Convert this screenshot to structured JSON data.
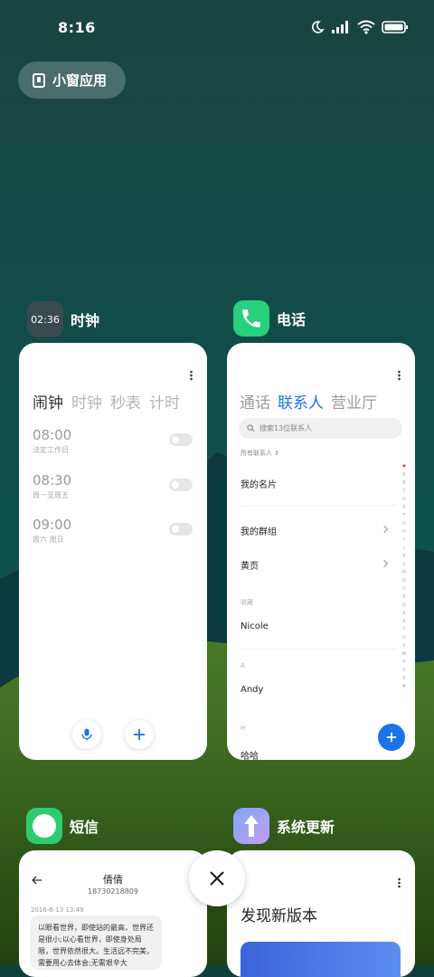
{
  "status_bar": {
    "time": "8:16"
  },
  "floating_window_button": {
    "label": "小窗应用"
  },
  "apps": {
    "clock": {
      "name": "时钟",
      "icon_time": "02:36",
      "tabs": [
        "闹钟",
        "时钟",
        "秒表",
        "计时"
      ],
      "alarms": [
        {
          "time": "08:00",
          "repeat": "法定工作日"
        },
        {
          "time": "08:30",
          "repeat": "周一至周五"
        },
        {
          "time": "09:00",
          "repeat": "周六 周日"
        }
      ]
    },
    "phone": {
      "name": "电话",
      "tabs": [
        "通话",
        "联系人",
        "营业厅"
      ],
      "search_placeholder": "搜索13位联系人",
      "filter_label": "所有联系人",
      "my_card": "我的名片",
      "my_groups": "我的群组",
      "yellow_pages": "黄页",
      "favorites_header": "收藏",
      "favorite_contact": "Nicole",
      "section_a": "A",
      "contact_a": "Andy",
      "section_h": "H",
      "contact_h": "哈哈",
      "index_letters": [
        "A",
        "B",
        "C",
        "D",
        "E",
        "F",
        "G",
        "H",
        "I",
        "J",
        "K",
        "L",
        "M",
        "N",
        "O",
        "P",
        "Q",
        "R",
        "S",
        "T",
        "U",
        "V",
        "W",
        "X",
        "Y",
        "Z",
        "#"
      ]
    },
    "messages": {
      "name": "短信",
      "contact_name": "倩倩",
      "contact_number": "18730218809",
      "timestamp": "2016-6-13 13:49",
      "message": "以眼看世界，即使站的最高，世界还是很小;以心看世界，即使身处局限，世界依然很大。生活远不完美，需要用心去体会;无需艰辛大"
    },
    "system_update": {
      "name": "系统更新",
      "headline": "发现新版本"
    }
  },
  "colors": {
    "accent": "#1a73e8",
    "phone_icon": "#26d07c",
    "sms_icon": "#2ecc71",
    "wallpaper_top": "#173f3c"
  }
}
